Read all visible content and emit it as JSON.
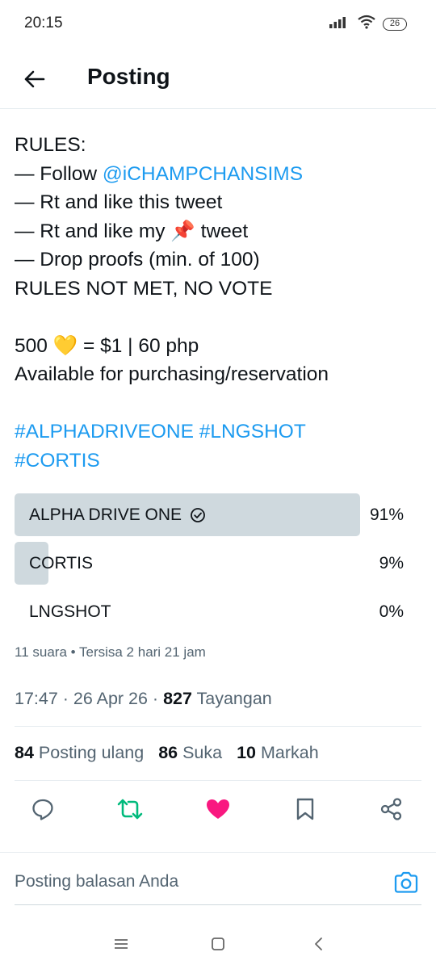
{
  "status_bar": {
    "time": "20:15",
    "battery": "26"
  },
  "header": {
    "title": "Posting"
  },
  "tweet": {
    "rules_heading": "RULES:",
    "rule1_prefix": "— Follow ",
    "rule1_handle": "@iCHAMPCHANSIMS",
    "rule2": "— Rt and like this tweet",
    "rule3_prefix": "— Rt and like my ",
    "rule3_emoji": "📌",
    "rule3_suffix": " tweet",
    "rule4": "— Drop proofs (min. of 100)",
    "rule5": "RULES NOT MET, NO VOTE",
    "price_prefix": "500 ",
    "price_emoji": "💛",
    "price_suffix": " = $1 | 60 php",
    "availability": "Available for purchasing/reservation",
    "hashtags_line1": "#ALPHADRIVEONE #LNGSHOT",
    "hashtags_line2": "#CORTIS"
  },
  "poll": {
    "options": [
      {
        "label": "ALPHA DRIVE ONE",
        "percent_label": "91%",
        "percent": 91,
        "selected": true
      },
      {
        "label": "CORTIS",
        "percent_label": "9%",
        "percent": 9,
        "selected": false
      },
      {
        "label": "LNGSHOT",
        "percent_label": "0%",
        "percent": 0,
        "selected": false
      }
    ],
    "meta": "11 suara • Tersisa 2 hari 21 jam"
  },
  "post_info": {
    "time_date": "17:47 · 26 Apr 26 · ",
    "views_count": "827",
    "views_label": " Tayangan"
  },
  "stats": {
    "reposts_count": "84",
    "reposts_label": " Posting ulang",
    "likes_count": "86",
    "likes_label": " Suka",
    "bookmarks_count": "10",
    "bookmarks_label": " Markah"
  },
  "colors": {
    "link": "#1d9bf0",
    "retweet_green": "#00ba7c",
    "like_pink": "#f91880",
    "poll_fill": "#cfd9de"
  },
  "reply": {
    "placeholder": "Posting balasan Anda"
  }
}
